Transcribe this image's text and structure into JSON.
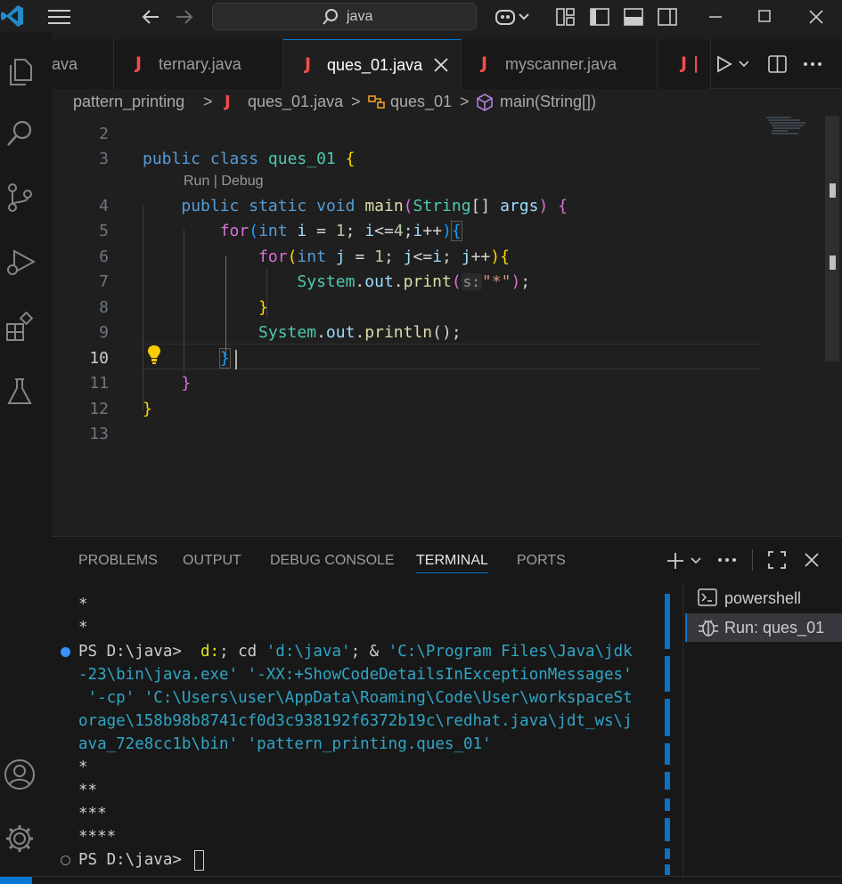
{
  "titlebar": {
    "search_text": "java"
  },
  "activity_bar": {
    "icons": [
      "files-icon",
      "search-icon",
      "source-control-icon",
      "run-debug-icon",
      "extensions-icon",
      "testing-icon",
      "account-icon",
      "settings-gear-icon"
    ]
  },
  "tabs": [
    {
      "label": "ava",
      "active": false
    },
    {
      "label": "ternary.java",
      "active": false
    },
    {
      "label": "ques_01.java",
      "active": true
    },
    {
      "label": "myscanner.java",
      "active": false
    }
  ],
  "tab_java_glyph": "J",
  "tab_overflow_glyph": "J |",
  "breadcrumb": {
    "folder": "pattern_printing",
    "file": "ques_01.java",
    "class": "ques_01",
    "method": "main(String[])",
    "sep": ">"
  },
  "editor": {
    "codelens": "Run | Debug",
    "current_line": "10",
    "line_numbers": [
      "2",
      "3",
      "4",
      "5",
      "6",
      "7",
      "8",
      "9",
      "10",
      "11",
      "12",
      "13"
    ],
    "code": {
      "l3": {
        "public": "public",
        "class": "class",
        "name": "ques_01",
        "brace": "{"
      },
      "l4": {
        "public": "public",
        "static": "static",
        "void": "void",
        "main": "main",
        "open": "(",
        "type": "String",
        "arr": "[]",
        "args": "args",
        "close": ")",
        "brace": "{"
      },
      "l5": {
        "for": "for",
        "open": "(",
        "int": "int",
        "i": "i",
        "eq": "=",
        "one": "1",
        "semi1": ";",
        "i2": "i",
        "lt": "<=",
        "four": "4",
        "semi2": ";",
        "i3": "i",
        "inc": "++",
        "close": ")",
        "brace": "{"
      },
      "l6": {
        "for": "for",
        "open": "(",
        "int": "int",
        "j": "j",
        "eq": "=",
        "one": "1",
        "semi1": ";",
        "j2": "j",
        "lt": "<=",
        "i": "i",
        "semi2": ";",
        "j3": "j",
        "inc": "++",
        "close": ")",
        "brace": "{"
      },
      "l7": {
        "sys": "System",
        "dot1": ".",
        "out": "out",
        "dot2": ".",
        "print": "print",
        "open": "(",
        "hint": "s:",
        "str": "\"*\"",
        "close": ")",
        "semi": ";"
      },
      "l8": {
        "brace": "}"
      },
      "l9": {
        "sys": "System",
        "dot1": ".",
        "out": "out",
        "dot2": ".",
        "println": "println",
        "parens": "()",
        "semi": ";"
      },
      "l10": {
        "brace": "}"
      },
      "l11": {
        "brace": "}"
      },
      "l12": {
        "brace": "}"
      }
    }
  },
  "panel": {
    "tabs": [
      "PROBLEMS",
      "OUTPUT",
      "DEBUG CONSOLE",
      "TERMINAL",
      "PORTS"
    ],
    "active_tab": "TERMINAL",
    "terminal_lines": {
      "star_a": "*",
      "star_b": "*",
      "prompt1": "PS D:\\java>",
      "cmd_d": "d:",
      "cmd_rest1": "; cd ",
      "cmd_path": "'d:\\java'",
      "cmd_amp": "; & ",
      "cmd_jdk": "'C:\\Program Files\\Java\\jdk",
      "line2": "-23\\bin\\java.exe' '-XX:+ShowCodeDetailsInExceptionMessages'",
      "line3": " '-cp' 'C:\\Users\\user\\AppData\\Roaming\\Code\\User\\workspaceSt",
      "line4": "orage\\158b98b8741cf0d3c938192f6372b19c\\redhat.java\\jdt_ws\\j",
      "line5": "ava_72e8cc1b\\bin' 'pattern_printing.ques_01'",
      "out1": "*",
      "out2": "**",
      "out3": "***",
      "out4": "****",
      "prompt2": "PS D:\\java>"
    },
    "terminal_list": [
      {
        "label": "powershell",
        "icon": "terminal-icon"
      },
      {
        "label": "Run: ques_01",
        "icon": "debug-icon"
      }
    ]
  }
}
